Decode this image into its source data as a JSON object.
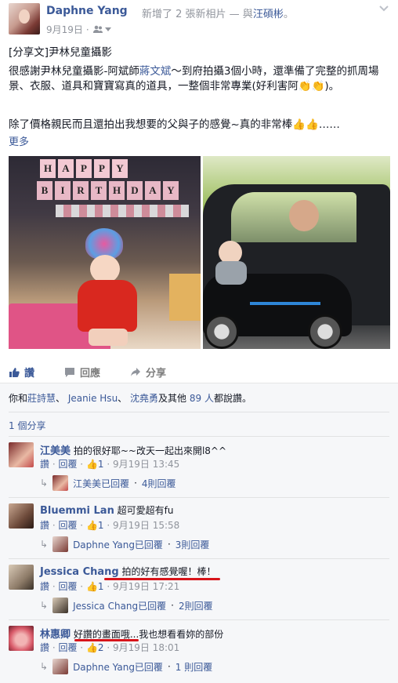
{
  "header": {
    "author": "Daphne Yang",
    "action_text": "新增了 2 張新相片 — 與",
    "tagged": "汪碩彬",
    "action_end": "。",
    "date": "9月19日",
    "audience_icon": "friends-icon"
  },
  "post": {
    "line1": "[分享文]尹林兒童攝影",
    "line2_a": "很感謝尹林兒童攝影-阿斌師",
    "line2_name": "蔣文斌",
    "line2_b": "～到府拍攝3個小時，還準備了完整的抓周場景、衣服、道具和寶寶寫真的道具，一整個非常專業(好利害阿👏👏)。",
    "line3": "除了價格親民而且還拍出我想要的父與子的感覺~真的非常棒👍👍……",
    "more": "更多",
    "banner_letters": [
      "H",
      "A",
      "P",
      "P",
      "Y"
    ],
    "banner_letters2": [
      "B",
      "I",
      "R",
      "T",
      "H",
      "D",
      "A",
      "Y"
    ]
  },
  "actions": {
    "like": "讚",
    "comment": "回應",
    "share": "分享"
  },
  "likes": {
    "prefix": "你和",
    "name1": "莊詩慧",
    "sep1": "、",
    "name2": "Jeanie Hsu",
    "sep2": "、",
    "name3": "沈堯勇",
    "mid": "及其他",
    "others": "89 人",
    "suffix": "都說讚。"
  },
  "shares": "1 個分享",
  "comments": [
    {
      "name": "江美美",
      "text": "拍的很好耶~~改天一起出來開l8^^",
      "like": "讚",
      "reply": "回覆",
      "count": "1",
      "date": "9月19日 13:45",
      "reply_by": "江美美已回覆",
      "reply_count": "4則回覆"
    },
    {
      "name": "Bluemmi Lan",
      "text": "超可愛超有fu",
      "like": "讚",
      "reply": "回覆",
      "count": "1",
      "date": "9月19日 15:58",
      "reply_by": "Daphne Yang已回覆",
      "reply_count": "3則回覆"
    },
    {
      "name": "Jessica Chang",
      "text": "拍的好有感覺喔！棒！",
      "like": "讚",
      "reply": "回覆",
      "count": "1",
      "date": "9月19日 17:21",
      "reply_by": "Jessica Chang已回覆",
      "reply_count": "2則回覆"
    },
    {
      "name": "林惠卿",
      "text_a": "好讚的畫面哦",
      "text_b": "...我也想看看妳的部份",
      "like": "讚",
      "reply": "回覆",
      "count": "2",
      "date": "9月19日 18:01",
      "reply_by": "Daphne Yang已回覆",
      "reply_count": "1 則回覆"
    }
  ],
  "colors": {
    "link": "#3b5998",
    "highlight": "#d7141a",
    "ufi_bg": "#f6f7f9"
  }
}
